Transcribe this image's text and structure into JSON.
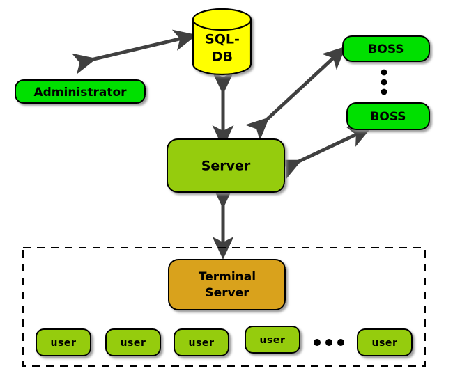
{
  "diagram": {
    "title": "System architecture diagram",
    "colors": {
      "bright_green": "#00E000",
      "yellow_green": "#95CC10",
      "yellow": "#FFFF00",
      "goldenrod": "#D9A21B",
      "arrow_gray": "#404040",
      "border_black": "#000000",
      "shadow": "#9a9a9a",
      "background": "#FFFFFF"
    },
    "nodes": {
      "database": {
        "label_line1": "SQL-",
        "label_line2": "DB",
        "shape": "cylinder",
        "fill": "#FFFF00"
      },
      "administrator": {
        "label": "Administrator",
        "shape": "rounded-rect",
        "fill": "#00E000"
      },
      "boss_top": {
        "label": "BOSS",
        "shape": "rounded-rect",
        "fill": "#00E000"
      },
      "boss_bottom": {
        "label": "BOSS",
        "shape": "rounded-rect",
        "fill": "#00E000"
      },
      "boss_ellipsis": {
        "label": "vertical-ellipsis",
        "dots": 3
      },
      "server": {
        "label": "Server",
        "shape": "rounded-rect",
        "fill": "#95CC10"
      },
      "terminal_server": {
        "label_line1": "Terminal",
        "label_line2": "Server",
        "shape": "rounded-rect",
        "fill": "#D9A21B"
      },
      "user_group": {
        "boundary": "dashed",
        "users": [
          {
            "label": "user"
          },
          {
            "label": "user"
          },
          {
            "label": "user"
          },
          {
            "label": "user"
          },
          {
            "label": "user"
          }
        ],
        "ellipsis": {
          "label": "horizontal-ellipsis",
          "dots": 3
        }
      }
    },
    "connections": [
      {
        "from": "administrator",
        "to": "database",
        "style": "double-arrow",
        "orientation": "diagonal"
      },
      {
        "from": "database",
        "to": "server",
        "style": "double-arrow",
        "orientation": "vertical"
      },
      {
        "from": "server",
        "to": "boss_top",
        "style": "double-arrow",
        "orientation": "diagonal"
      },
      {
        "from": "server",
        "to": "boss_bottom",
        "style": "double-arrow",
        "orientation": "diagonal"
      },
      {
        "from": "server",
        "to": "user_group",
        "style": "double-arrow",
        "orientation": "vertical"
      }
    ]
  }
}
